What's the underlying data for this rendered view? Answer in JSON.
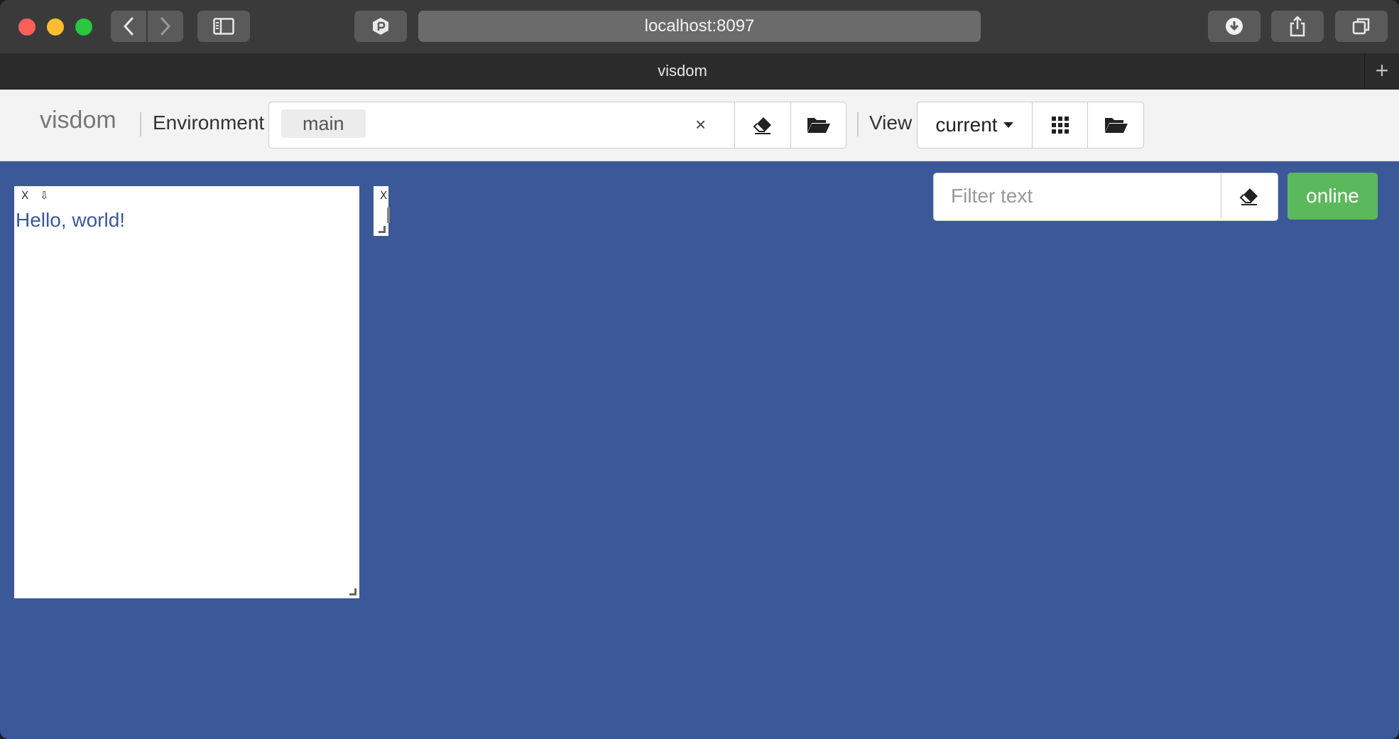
{
  "browser": {
    "url": "localhost:8097",
    "tab_title": "visdom",
    "new_tab_symbol": "+"
  },
  "header": {
    "brand": "visdom",
    "environment_label": "Environment",
    "environment_selected": "main",
    "clear_symbol": "×",
    "view_label": "View",
    "view_selected": "current"
  },
  "controls": {
    "filter_placeholder": "Filter text",
    "status_label": "online",
    "status_color": "#5cb85c"
  },
  "panes": [
    {
      "close_label": "X",
      "download_symbol": "⇩",
      "text": "Hello, world!"
    },
    {
      "close_label": "X"
    }
  ],
  "colors": {
    "background": "#3b5998",
    "text_accent": "#3b5998"
  }
}
